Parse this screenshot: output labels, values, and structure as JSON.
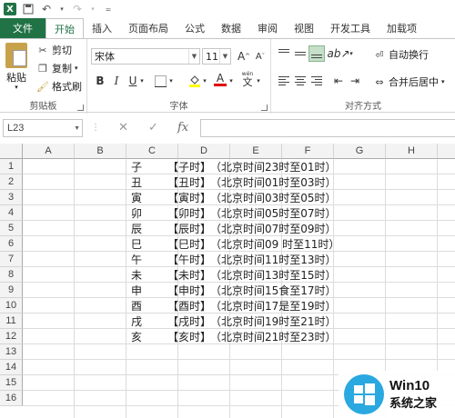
{
  "titlebar": {
    "app_icon": "X"
  },
  "tabs": [
    "文件",
    "开始",
    "插入",
    "页面布局",
    "公式",
    "数据",
    "审阅",
    "视图",
    "开发工具",
    "加载项"
  ],
  "clipboard": {
    "paste": "粘贴",
    "cut": "剪切",
    "copy": "复制",
    "format_painter": "格式刷",
    "group_label": "剪贴板"
  },
  "font": {
    "name": "宋体",
    "size": "11",
    "bold": "B",
    "italic": "I",
    "underline": "U",
    "grow": "A",
    "shrink": "A",
    "phonetic": "wén",
    "font_color_letter": "A",
    "group_label": "字体"
  },
  "alignment": {
    "wrap_text": "自动换行",
    "merge_center": "合并后居中",
    "group_label": "对齐方式"
  },
  "formula_bar": {
    "name_box": "L23",
    "cancel": "✕",
    "confirm": "✓",
    "fx": "fx",
    "formula": ""
  },
  "columns": [
    "A",
    "B",
    "C",
    "D",
    "E",
    "F",
    "G",
    "H"
  ],
  "rows": [
    "1",
    "2",
    "3",
    "4",
    "5",
    "6",
    "7",
    "8",
    "9",
    "10",
    "11",
    "12",
    "13",
    "14",
    "15",
    "16"
  ],
  "table": [
    {
      "c": "子",
      "d": "【子时】",
      "e": "（北京时间23时至01时）"
    },
    {
      "c": "丑",
      "d": "【丑时】",
      "e": "（北京时间01时至03时）"
    },
    {
      "c": "寅",
      "d": "【寅时】",
      "e": "（北京时间03时至05时）"
    },
    {
      "c": "卯",
      "d": "【卯时】",
      "e": "（北京时间05时至07时）"
    },
    {
      "c": "辰",
      "d": "【辰时】",
      "e": "（北京时间07时至09时）"
    },
    {
      "c": "巳",
      "d": "【巳时】",
      "e": "（北京时间09 时至11时）"
    },
    {
      "c": "午",
      "d": "【午时】",
      "e": "（北京时间11时至13时）"
    },
    {
      "c": "未",
      "d": "【未时】",
      "e": "（北京时间13时至15时）"
    },
    {
      "c": "申",
      "d": "【申时】",
      "e": "（北京时间15食至17时）"
    },
    {
      "c": "酉",
      "d": "【酉时】",
      "e": "（北京时间17是至19时）"
    },
    {
      "c": "戌",
      "d": "【戌时】",
      "e": "（北京时间19时至21时）"
    },
    {
      "c": "亥",
      "d": "【亥时】",
      "e": "（北京时间21时至23时）"
    }
  ],
  "watermark": {
    "line1": "Win10",
    "line2": "系统之家"
  },
  "colors": {
    "accent": "#217346",
    "watermark_blue": "#2aa8e0"
  }
}
